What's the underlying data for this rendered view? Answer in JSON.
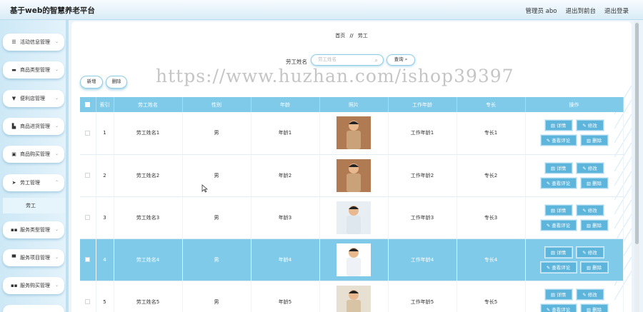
{
  "header": {
    "title": "基于web的智慧养老平台",
    "links": [
      "管理员 abo",
      "退出到前台",
      "退出登录"
    ]
  },
  "sidebar": {
    "items": [
      {
        "label": "活动信息管理",
        "icon": "list-icon"
      },
      {
        "label": "商品类型管理",
        "icon": "folder-icon"
      },
      {
        "label": "便利店管理",
        "icon": "cup-icon"
      },
      {
        "label": "商品进货管理",
        "icon": "chart-icon"
      },
      {
        "label": "商品购买管理",
        "icon": "box-icon"
      },
      {
        "label": "劳工管理",
        "icon": "send-icon",
        "expanded": true
      },
      {
        "label": "服务类型管理",
        "icon": "grid-icon"
      },
      {
        "label": "服务项目管理",
        "icon": "monitor-icon"
      },
      {
        "label": "服务购买管理",
        "icon": "grid-icon"
      }
    ],
    "submenu": [
      "劳工"
    ]
  },
  "breadcrumb": {
    "home": "首页",
    "sep": "//",
    "current": "劳工"
  },
  "search": {
    "label": "劳工姓名",
    "placeholder": "劳工姓名",
    "button": "查询"
  },
  "actions": {
    "add": "新增",
    "delete": "删除"
  },
  "table": {
    "columns": [
      "",
      "索引",
      "劳工姓名",
      "性别",
      "年龄",
      "照片",
      "工作年龄",
      "专长",
      "操作"
    ],
    "rows": [
      {
        "index": "1",
        "name": "劳工姓名1",
        "gender": "男",
        "age": "年龄1",
        "work": "工作年龄1",
        "skill": "专长1"
      },
      {
        "index": "2",
        "name": "劳工姓名2",
        "gender": "男",
        "age": "年龄2",
        "work": "工作年龄2",
        "skill": "专长2"
      },
      {
        "index": "3",
        "name": "劳工姓名3",
        "gender": "男",
        "age": "年龄3",
        "work": "工作年龄3",
        "skill": "专长3"
      },
      {
        "index": "4",
        "name": "劳工姓名4",
        "gender": "男",
        "age": "年龄4",
        "work": "工作年龄4",
        "skill": "专长4"
      },
      {
        "index": "5",
        "name": "劳工姓名5",
        "gender": "男",
        "age": "年龄5",
        "work": "工作年龄5",
        "skill": "专长5"
      }
    ],
    "highlighted_row": 4,
    "ops": {
      "detail": "详情",
      "edit": "修改",
      "comments": "查看评论",
      "delete": "删除"
    }
  },
  "watermark": "https://www.huzhan.com/ishop39397",
  "colors": {
    "accent": "#7fcae8",
    "button": "#5db5dc"
  }
}
